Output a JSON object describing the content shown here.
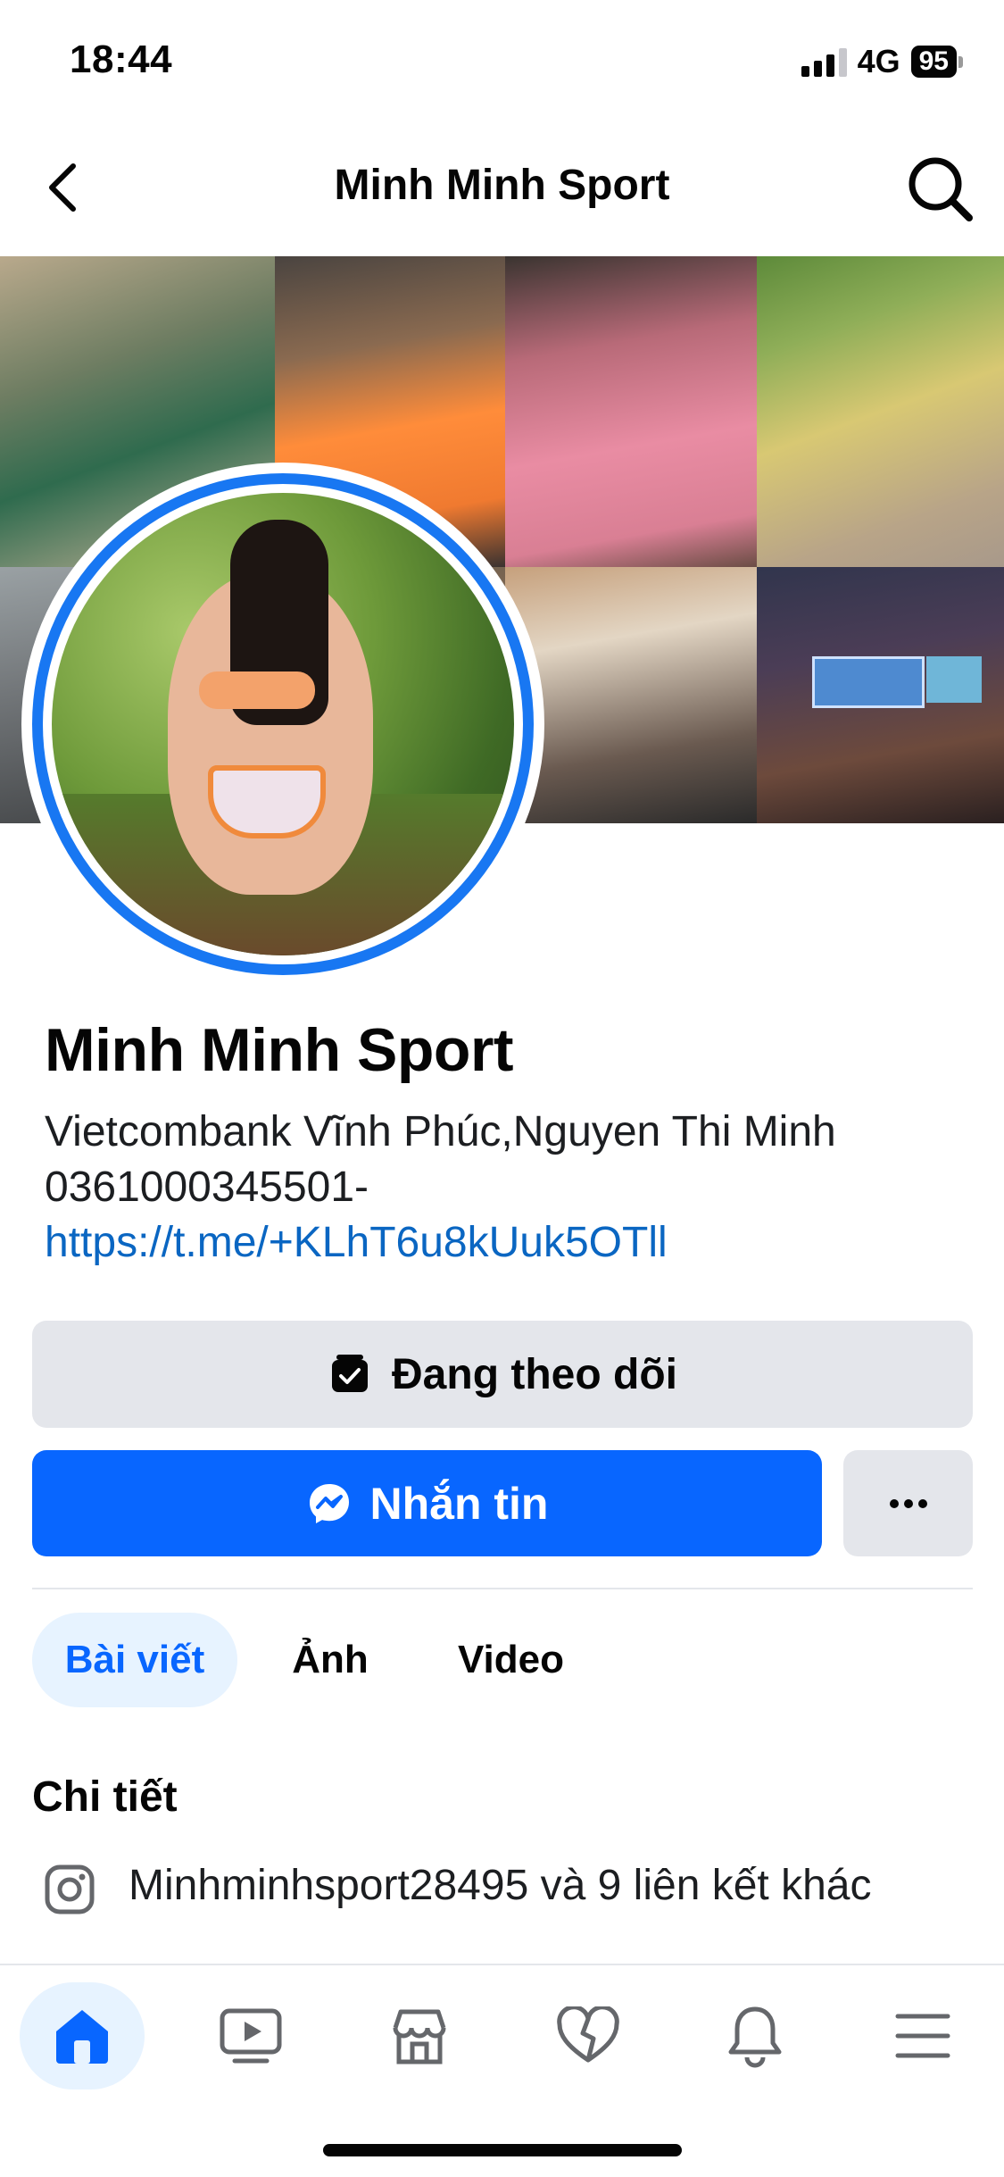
{
  "status_bar": {
    "time": "18:44",
    "network": "4G",
    "battery": "95"
  },
  "nav": {
    "title": "Minh Minh Sport",
    "back_icon": "chevron-left-icon",
    "search_icon": "search-icon"
  },
  "profile": {
    "name": "Minh Minh Sport",
    "bio_text": "Vietcombank Vĩnh Phúc,Nguyen Thi Minh 0361000345501- ",
    "bio_link": "https://t.me/+KLhT6u8kUuk5OTll"
  },
  "actions": {
    "follow_label": "Đang theo dõi",
    "message_label": "Nhắn tin",
    "more_icon": "more-horizontal-icon"
  },
  "tabs": [
    {
      "label": "Bài viết",
      "active": true
    },
    {
      "label": "Ảnh",
      "active": false
    },
    {
      "label": "Video",
      "active": false
    }
  ],
  "details": {
    "title": "Chi tiết",
    "instagram_text": "Minhminhsport28495 và 9 liên kết khác"
  },
  "bottom_nav": [
    {
      "name": "home-icon",
      "active": true
    },
    {
      "name": "video-icon",
      "active": false
    },
    {
      "name": "marketplace-icon",
      "active": false
    },
    {
      "name": "dating-icon",
      "active": false
    },
    {
      "name": "notifications-icon",
      "active": false
    },
    {
      "name": "menu-icon",
      "active": false
    }
  ],
  "colors": {
    "accent": "#0866ff",
    "ring": "#1877f2",
    "active_tab_bg": "#e7f3ff",
    "button_gray": "#e4e6eb",
    "link": "#0a66c2"
  }
}
